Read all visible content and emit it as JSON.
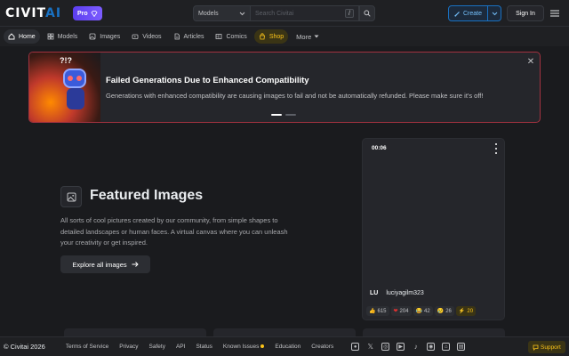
{
  "header": {
    "logo_main": "CIVIT",
    "logo_accent": "AI",
    "pro_label": "Pro",
    "search": {
      "category": "Models",
      "placeholder": "Search Civitai",
      "shortcut": "/"
    },
    "create_label": "Create",
    "signin_label": "Sign In"
  },
  "nav": {
    "items": [
      {
        "label": "Home",
        "icon": "home-icon",
        "active": true
      },
      {
        "label": "Models",
        "icon": "models-icon"
      },
      {
        "label": "Images",
        "icon": "images-icon"
      },
      {
        "label": "Videos",
        "icon": "videos-icon"
      },
      {
        "label": "Articles",
        "icon": "articles-icon"
      },
      {
        "label": "Comics",
        "icon": "comics-icon"
      },
      {
        "label": "Shop",
        "icon": "shop-icon"
      }
    ],
    "more_label": "More"
  },
  "banner": {
    "title": "Failed Generations Due to Enhanced Compatibility",
    "text": "Generations with enhanced compatibility are causing images to fail and not be automatically refunded. Please make sure it's off!",
    "slides": 2,
    "active_slide": 1
  },
  "featured": {
    "title": "Featured Images",
    "description": "All sorts of cool pictures created by our community, from simple shapes to detailed landscapes or human faces. A virtual canvas where you can unleash your creativity or get inspired.",
    "button_label": "Explore all images"
  },
  "card": {
    "duration": "00:06",
    "avatar_initials": "LU",
    "username": "luciyagilm323",
    "reactions": [
      {
        "icon": "thumbs-up-icon",
        "count": "615"
      },
      {
        "icon": "heart-icon",
        "count": "204"
      },
      {
        "icon": "laugh-icon",
        "count": "42"
      },
      {
        "icon": "cry-icon",
        "count": "26"
      },
      {
        "icon": "bolt-icon",
        "count": "20"
      }
    ]
  },
  "footer": {
    "copyright": "© Civitai 2026",
    "links": [
      "Terms of Service",
      "Privacy",
      "Safety",
      "API",
      "Status",
      "Known Issues",
      "Education",
      "Creators"
    ],
    "support_label": "Support"
  },
  "colors": {
    "background": "#1a1b1e",
    "accent_blue": "#1971c2",
    "banner_border": "#a33240",
    "gold": "#fcc419",
    "pro_purple": "#6a4cf5"
  }
}
